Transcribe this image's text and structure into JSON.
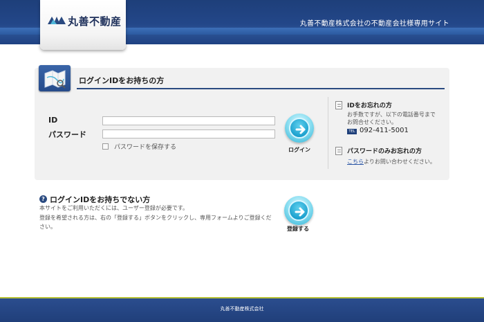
{
  "header": {
    "logo_text": "丸善不動産",
    "tagline": "丸善不動産株式会社の不動産会社様専用サイト"
  },
  "login": {
    "title": "ログインIDをお持ちの方",
    "id_label": "ID",
    "password_label": "パスワード",
    "id_value": "",
    "password_value": "",
    "remember_label": "パスワードを保存する",
    "button_label": "ログイン"
  },
  "sidebar": {
    "forgot_id_title": "IDをお忘れの方",
    "forgot_id_text_1": "お手数ですが、以下の電話番号まで",
    "forgot_id_text_2": "お問合せください。",
    "tel_badge": "TEL",
    "tel_number": "092-411-5001",
    "forgot_pw_title": "パスワードのみお忘れの方",
    "forgot_pw_link": "こちら",
    "forgot_pw_text": "よりお問い合わせください。"
  },
  "register": {
    "title": "ログインIDをお持ちでない方",
    "line_1": "本サイトをご利用いただくには、ユーザー登録が必要です。",
    "line_2": "登録を希望される方は、右の「登録する」ボタンをクリックし、専用フォームよりご登録くだ",
    "line_3": "さい。",
    "button_label": "登録する"
  },
  "footer": {
    "company": "丸善不動産株式会社"
  },
  "colors": {
    "header_navy": "#1e3f7a",
    "accent_cyan": "#2fb3d6",
    "footer_accent": "#b7c235"
  }
}
